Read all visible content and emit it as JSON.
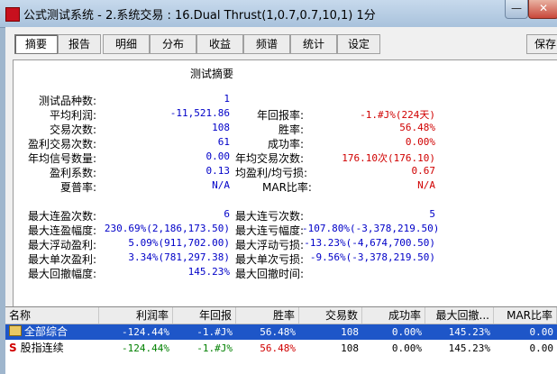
{
  "window": {
    "title": "公式测试系统 - 2.系统交易 : 16.Dual Thrust(1,0.7,0.7,10,1) 1分",
    "minimize": "—",
    "close": "✕"
  },
  "toolbar": {
    "tabs": [
      "摘要",
      "报告",
      "明细",
      "分布",
      "收益",
      "频谱",
      "统计",
      "设定"
    ],
    "active_tab": "摘要",
    "save": "保存"
  },
  "summary": {
    "title": "测试摘要",
    "left": [
      {
        "label": "测试品种数:",
        "value": "1",
        "color": "#0000c8"
      },
      {
        "label": "平均利润:",
        "value": "-11,521.86",
        "color": "#0000c8"
      },
      {
        "label": "交易次数:",
        "value": "108",
        "color": "#0000c8"
      },
      {
        "label": "盈利交易次数:",
        "value": "61",
        "color": "#0000c8"
      },
      {
        "label": "年均信号数量:",
        "value": "0.00",
        "color": "#0000c8"
      },
      {
        "label": "盈利系数:",
        "value": "0.13",
        "color": "#0000c8"
      },
      {
        "label": "夏普率:",
        "value": "N/A",
        "color": "#0000c8"
      }
    ],
    "right": [
      {
        "label": "年回报率:",
        "value": "-1.#J%(224天)",
        "color": "#d00000"
      },
      {
        "label": "胜率:",
        "value": "56.48%",
        "color": "#d00000"
      },
      {
        "label": "成功率:",
        "value": "0.00%",
        "color": "#d00000"
      },
      {
        "label": "年均交易次数:",
        "value": "176.10次(176.10)",
        "color": "#d00000"
      },
      {
        "label": "均盈利/均亏损:",
        "value": "0.67",
        "color": "#d00000"
      },
      {
        "label": "MAR比率:",
        "value": "N/A",
        "color": "#d00000"
      }
    ],
    "lower_left": [
      {
        "label": "最大连盈次数:",
        "value": "6"
      },
      {
        "label": "最大连盈幅度:",
        "value": "230.69%(2,186,173.50)"
      },
      {
        "label": "最大浮动盈利:",
        "value": "5.09%(911,702.00)"
      },
      {
        "label": "最大单次盈利:",
        "value": "3.34%(781,297.38)"
      },
      {
        "label": "最大回撤幅度:",
        "value": "145.23%"
      }
    ],
    "lower_right": [
      {
        "label": "最大连亏次数:",
        "value": "5"
      },
      {
        "label": "最大连亏幅度:",
        "value": "-107.80%(-3,378,219.50)"
      },
      {
        "label": "最大浮动亏损:",
        "value": "-13.23%(-4,674,700.50)"
      },
      {
        "label": "最大单次亏损:",
        "value": "-9.56%(-3,378,219.50)"
      },
      {
        "label": "最大回撤时间:",
        "value": ""
      }
    ]
  },
  "grid": {
    "columns": [
      "名称",
      "利润率",
      "年回报",
      "胜率",
      "交易数",
      "成功率",
      "最大回撤...",
      "MAR比率"
    ],
    "rows": [
      {
        "icon": "folder-icon",
        "name": "全部综合",
        "values": [
          "-124.44%",
          "-1.#J%",
          "56.48%",
          "108",
          "0.00%",
          "145.23%",
          "0.00"
        ],
        "selected": true
      },
      {
        "icon": "s-logo-icon",
        "name": "股指连续",
        "values": [
          "-124.44%",
          "-1.#J%",
          "56.48%",
          "108",
          "0.00%",
          "145.23%",
          "0.00"
        ],
        "selected": false
      }
    ]
  }
}
